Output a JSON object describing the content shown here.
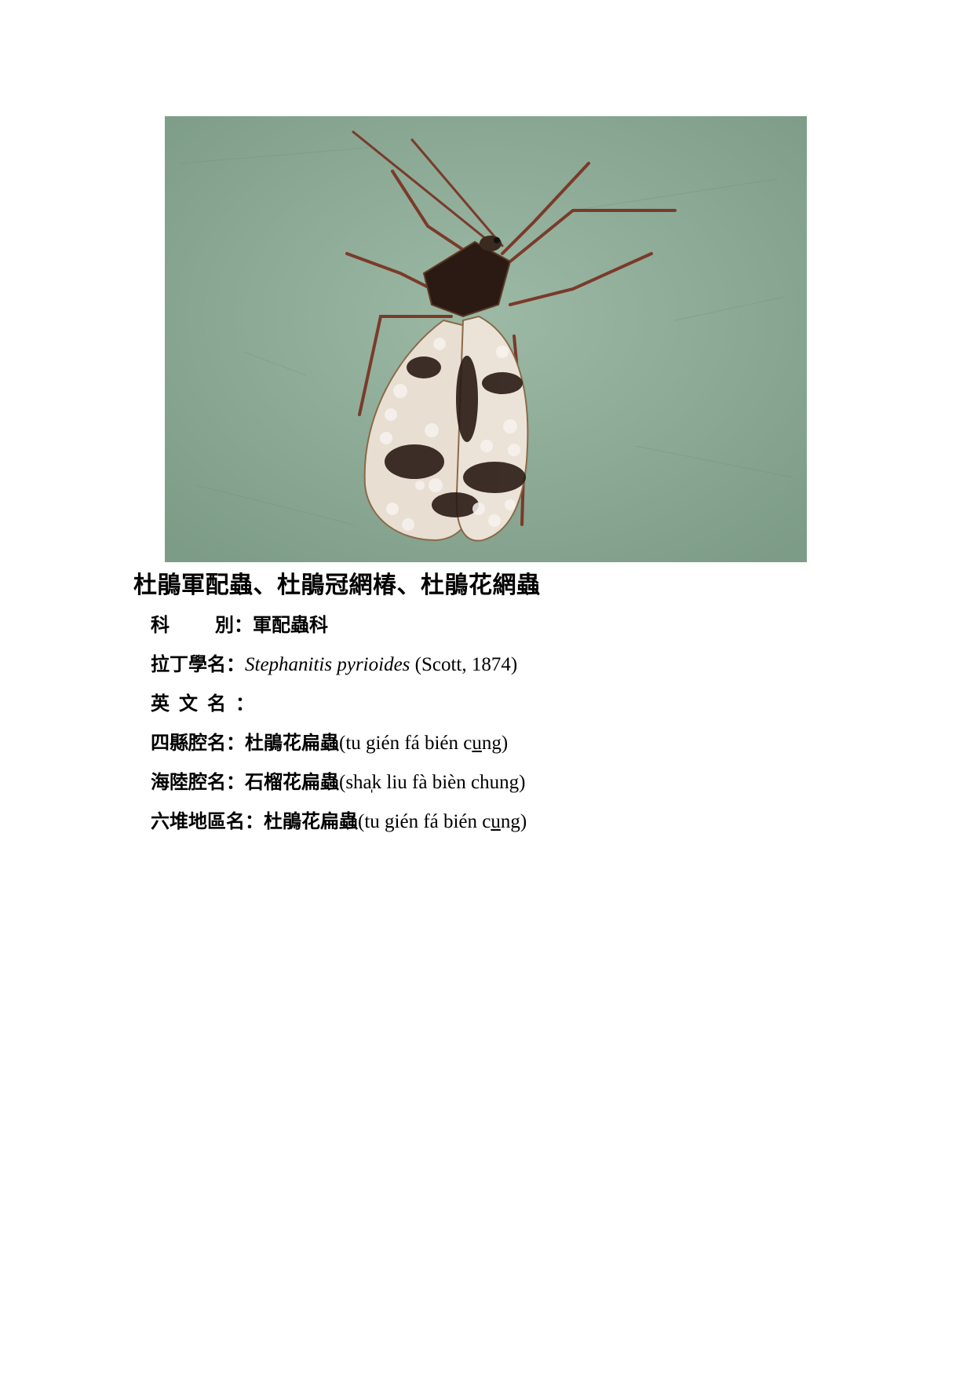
{
  "title": "杜鵑軍配蟲、杜鵑冠網椿、杜鵑花網蟲",
  "photo": {
    "subject": "azalea lace bug on green surface",
    "colors": {
      "background": "#8fae99",
      "body_dark": "#2a1a14",
      "wing_light": "#efe7df",
      "leg": "#7a3a2a"
    }
  },
  "fields": {
    "family": {
      "label_a": "科",
      "label_b": "別",
      "colon": "：",
      "value": "軍配蟲科"
    },
    "latin": {
      "label": "拉丁學名",
      "colon": "：",
      "genus_species": "Stephanitis pyrioides",
      "author": " (Scott, 1874)"
    },
    "english": {
      "label": "英文名",
      "colon": "："
    },
    "sixian": {
      "label": "四縣腔名",
      "colon": "：",
      "cjk": "杜鵑花扁蟲",
      "rom_before": "(tu gién fá bién c",
      "rom_ul": "u",
      "rom_after": "ng)"
    },
    "hailu": {
      "label": "海陸腔名",
      "colon": "：",
      "cjk": "石榴花扁蟲",
      "rom": "(sha̩k liu fà bièn chung)"
    },
    "liudui": {
      "label": "六堆地區名",
      "colon": "：",
      "cjk": "杜鵑花扁蟲",
      "rom_before": "(tu gién fá bién c",
      "rom_ul": "u",
      "rom_after": "ng)"
    }
  }
}
